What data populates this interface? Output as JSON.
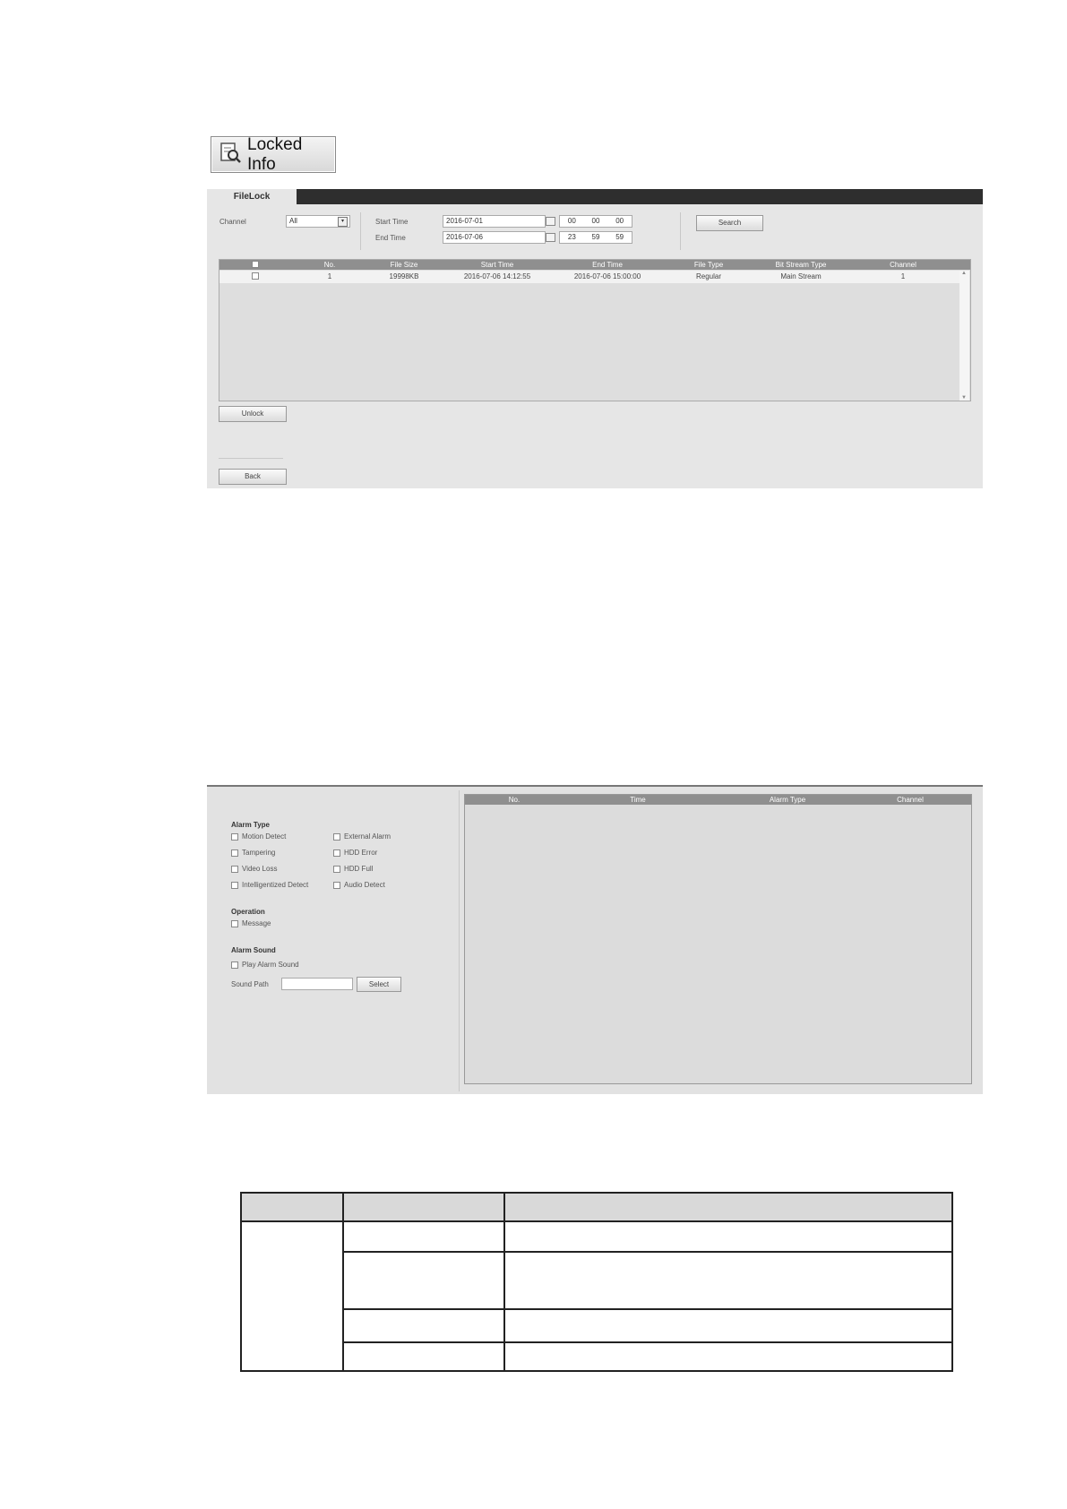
{
  "locked_info": {
    "label": "Locked Info"
  },
  "filelock": {
    "tab": "FileLock",
    "channel_label": "Channel",
    "channel_value": "All",
    "start_time_label": "Start Time",
    "start_date": "2016-07-01",
    "start_h": "00",
    "start_m": "00",
    "start_s": "00",
    "end_time_label": "End Time",
    "end_date": "2016-07-06",
    "end_h": "23",
    "end_m": "59",
    "end_s": "59",
    "search_label": "Search",
    "columns": [
      "No.",
      "File Size",
      "Start Time",
      "End Time",
      "File Type",
      "Bit Stream Type",
      "Channel"
    ],
    "rows": [
      {
        "no": "1",
        "size": "19998KB",
        "start": "2016-07-06 14:12:55",
        "end": "2016-07-06 15:00:00",
        "type": "Regular",
        "stream": "Main Stream",
        "channel": "1"
      }
    ],
    "unlock_label": "Unlock",
    "back_label": "Back"
  },
  "alarm": {
    "type_title": "Alarm Type",
    "types": [
      "Motion Detect",
      "External Alarm",
      "Tampering",
      "HDD Error",
      "Video Loss",
      "HDD Full",
      "Intelligentized Detect",
      "Audio Detect"
    ],
    "operation_title": "Operation",
    "message_label": "Message",
    "sound_title": "Alarm Sound",
    "play_label": "Play Alarm Sound",
    "sound_path_label": "Sound Path",
    "select_label": "Select",
    "columns": [
      "No.",
      "Time",
      "Alarm Type",
      "Channel"
    ]
  }
}
